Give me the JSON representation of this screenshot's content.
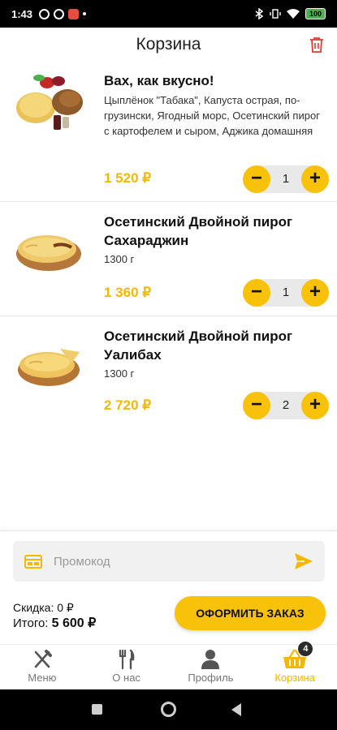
{
  "status_bar": {
    "time": "1:43",
    "battery": "100"
  },
  "header": {
    "title": "Корзина"
  },
  "cart": {
    "items": [
      {
        "name": "Вах, как вкусно!",
        "description": "Цыплёнок \"Табака\", Капуста острая, по-грузински, Ягодный морс, Осетинский пирог с картофелем и сыром, Аджика домашняя",
        "price": "1 520 ₽",
        "quantity": "1"
      },
      {
        "name": "Осетинский Двойной пирог Сахараджин",
        "weight": "1300 г",
        "price": "1 360 ₽",
        "quantity": "1"
      },
      {
        "name": "Осетинский Двойной пирог Уалибах",
        "weight": "1300 г",
        "price": "2 720 ₽",
        "quantity": "2"
      }
    ]
  },
  "checkout": {
    "promo_placeholder": "Промокод",
    "discount_label": "Скидка:",
    "discount_value": "0 ₽",
    "total_label": "Итого:",
    "total_value": "5 600 ₽",
    "order_button": "ОФОРМИТЬ ЗАКАЗ"
  },
  "nav": {
    "items": [
      {
        "label": "Меню",
        "icon": "fork-knife-icon"
      },
      {
        "label": "О нас",
        "icon": "cutlery-icon"
      },
      {
        "label": "Профиль",
        "icon": "profile-icon"
      },
      {
        "label": "Корзина",
        "icon": "basket-icon",
        "badge": "4"
      }
    ]
  },
  "colors": {
    "accent": "#f8c10a",
    "price": "#f5b800",
    "trash": "#e53935"
  }
}
